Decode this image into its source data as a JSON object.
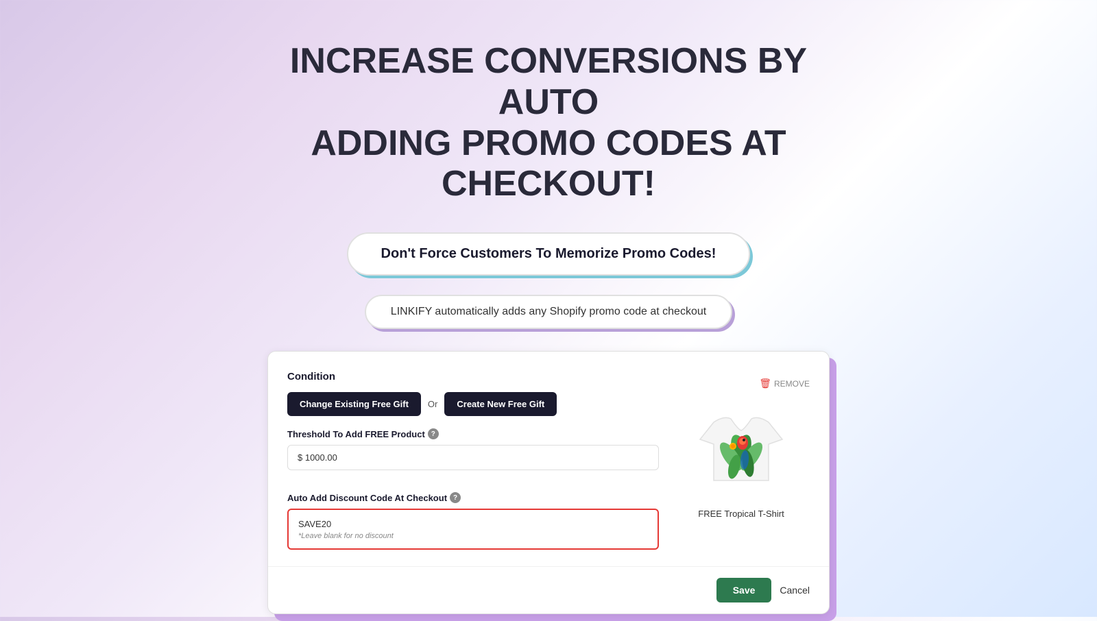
{
  "headline": {
    "line1": "INCREASE CONVERSIONS BY AUTO",
    "line2": "ADDING PROMO CODES AT CHECKOUT!"
  },
  "pill_primary": {
    "text": "Don't Force Customers To Memorize Promo Codes!"
  },
  "pill_secondary": {
    "text": "LINKIFY automatically adds any Shopify promo code at checkout"
  },
  "card": {
    "condition_label": "Condition",
    "change_gift_btn": "Change Existing Free Gift",
    "or_label": "Or",
    "create_gift_btn": "Create New Free Gift",
    "threshold_label": "Threshold To Add FREE Product",
    "threshold_value": "$ 1000.00",
    "discount_label": "Auto Add Discount Code At Checkout",
    "discount_value": "SAVE20",
    "discount_hint": "*Leave blank for no discount",
    "remove_label": "REMOVE",
    "product_name": "FREE Tropical T-Shirt",
    "save_btn": "Save",
    "cancel_btn": "Cancel"
  }
}
